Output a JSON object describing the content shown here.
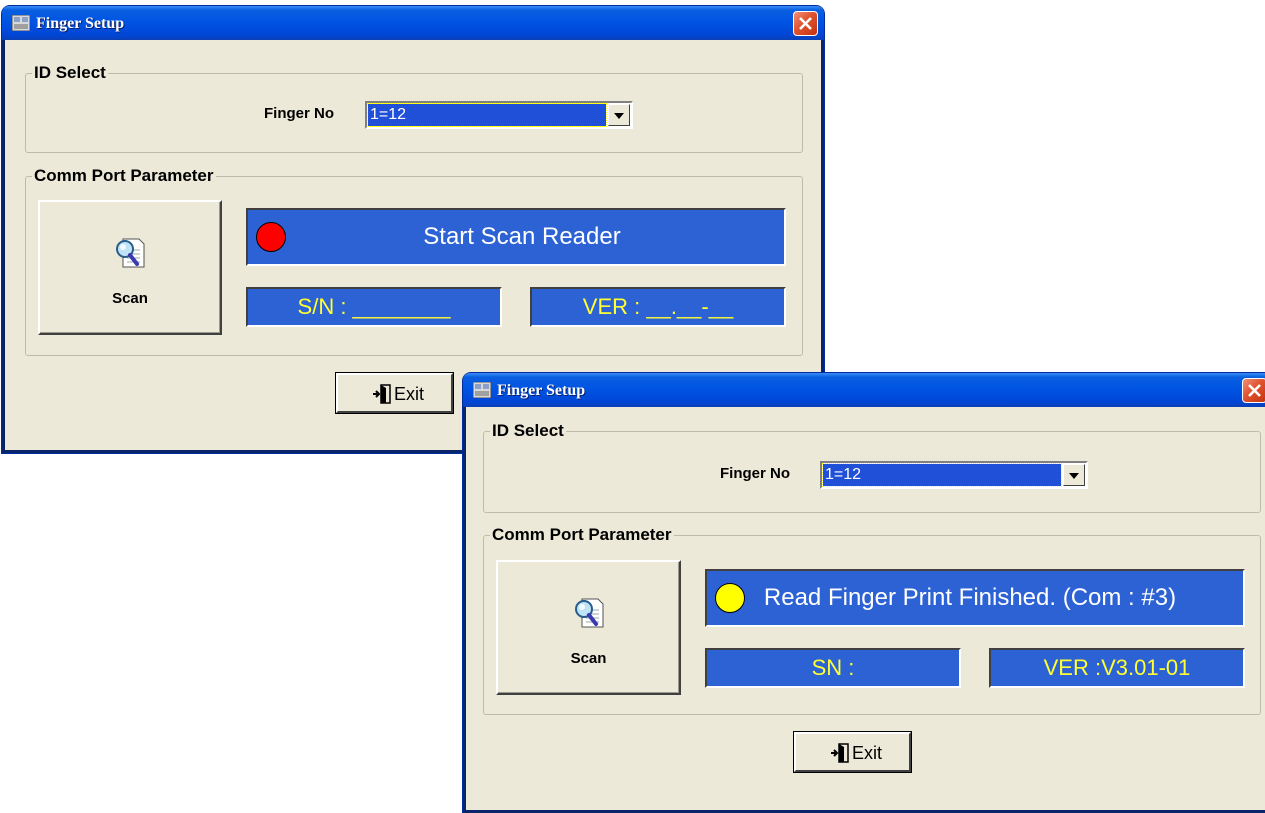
{
  "windows": [
    {
      "title": "Finger Setup",
      "id_select_legend": "ID Select",
      "finger_no_label": "Finger No",
      "finger_no_value": "1=12",
      "comm_legend": "Comm Port Parameter",
      "scan_label": "Scan",
      "status_text": "Start Scan Reader",
      "status_color": "#ff0000",
      "sn_text": "S/N : ________",
      "ver_text": "VER : __.__-__",
      "exit_label": "Exit"
    },
    {
      "title": "Finger Setup",
      "id_select_legend": "ID Select",
      "finger_no_label": "Finger No",
      "finger_no_value": "1=12",
      "comm_legend": "Comm Port Parameter",
      "scan_label": "Scan",
      "status_text": "Read Finger Print Finished. (Com : #3)",
      "status_color": "#ffff00",
      "sn_text": "SN :",
      "ver_text": "VER :V3.01-01",
      "exit_label": "Exit"
    }
  ]
}
